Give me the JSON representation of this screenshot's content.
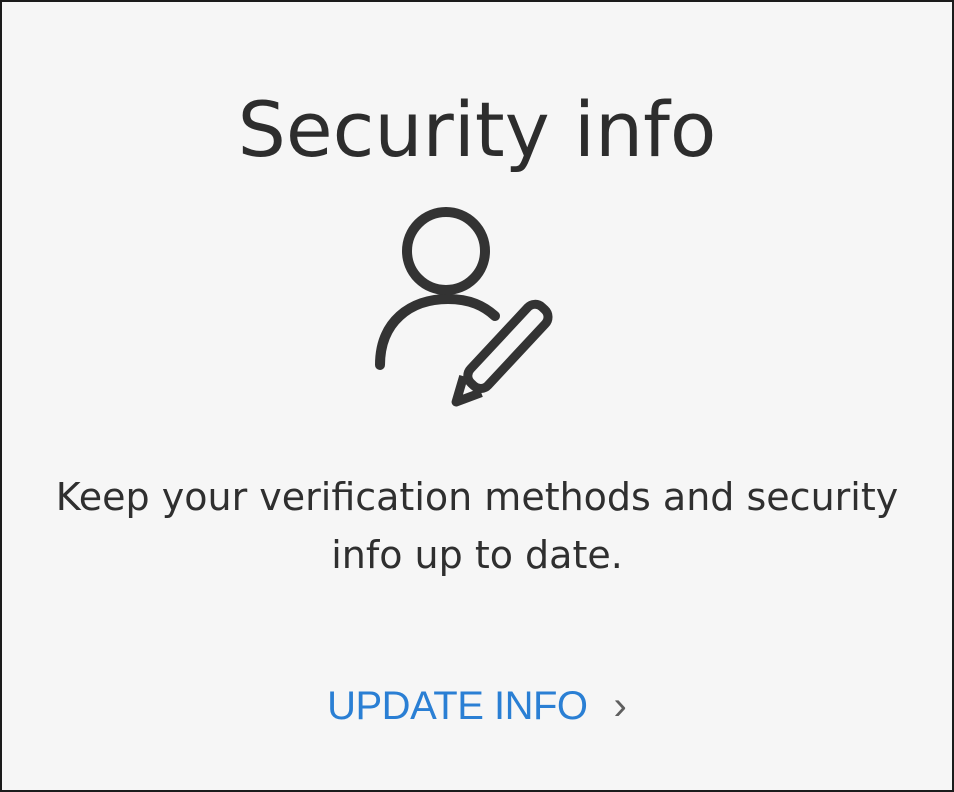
{
  "card": {
    "title": "Security info",
    "icon": "user-edit-icon",
    "description": "Keep your verification methods and security info up to date.",
    "link_label": "UPDATE INFO",
    "link_chevron": "›",
    "link_icon": "chevron-right-icon"
  },
  "colors": {
    "background": "#f6f6f6",
    "border": "#1b1b1b",
    "text": "#2d2d2d",
    "link": "#2a7fd4"
  }
}
